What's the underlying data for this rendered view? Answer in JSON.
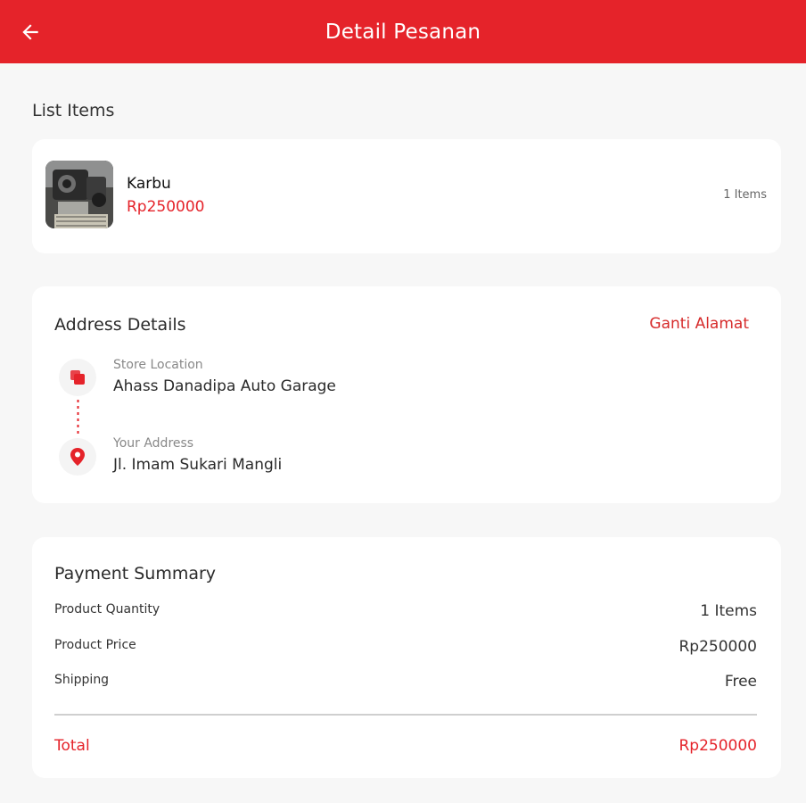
{
  "header": {
    "title": "Detail Pesanan"
  },
  "list": {
    "label": "List Items",
    "item": {
      "name": "Karbu",
      "price": "Rp250000",
      "quantity": "1 Items"
    }
  },
  "address": {
    "title": "Address Details",
    "change_label": "Ganti Alamat",
    "store": {
      "label": "Store Location",
      "value": "Ahass Danadipa Auto Garage"
    },
    "user": {
      "label": "Your Address",
      "value": "Jl. Imam Sukari Mangli"
    }
  },
  "payment": {
    "title": "Payment Summary",
    "rows": [
      {
        "label": "Product Quantity",
        "value": "1 Items"
      },
      {
        "label": "Product Price",
        "value": "Rp250000"
      },
      {
        "label": "Shipping",
        "value": "Free"
      }
    ],
    "total": {
      "label": "Total",
      "value": "Rp250000"
    }
  },
  "colors": {
    "primary": "#e5232a",
    "background": "#f7f7f7",
    "card": "#ffffff"
  },
  "icons": [
    "arrow-left-icon",
    "store-icon",
    "location-pin-icon"
  ]
}
